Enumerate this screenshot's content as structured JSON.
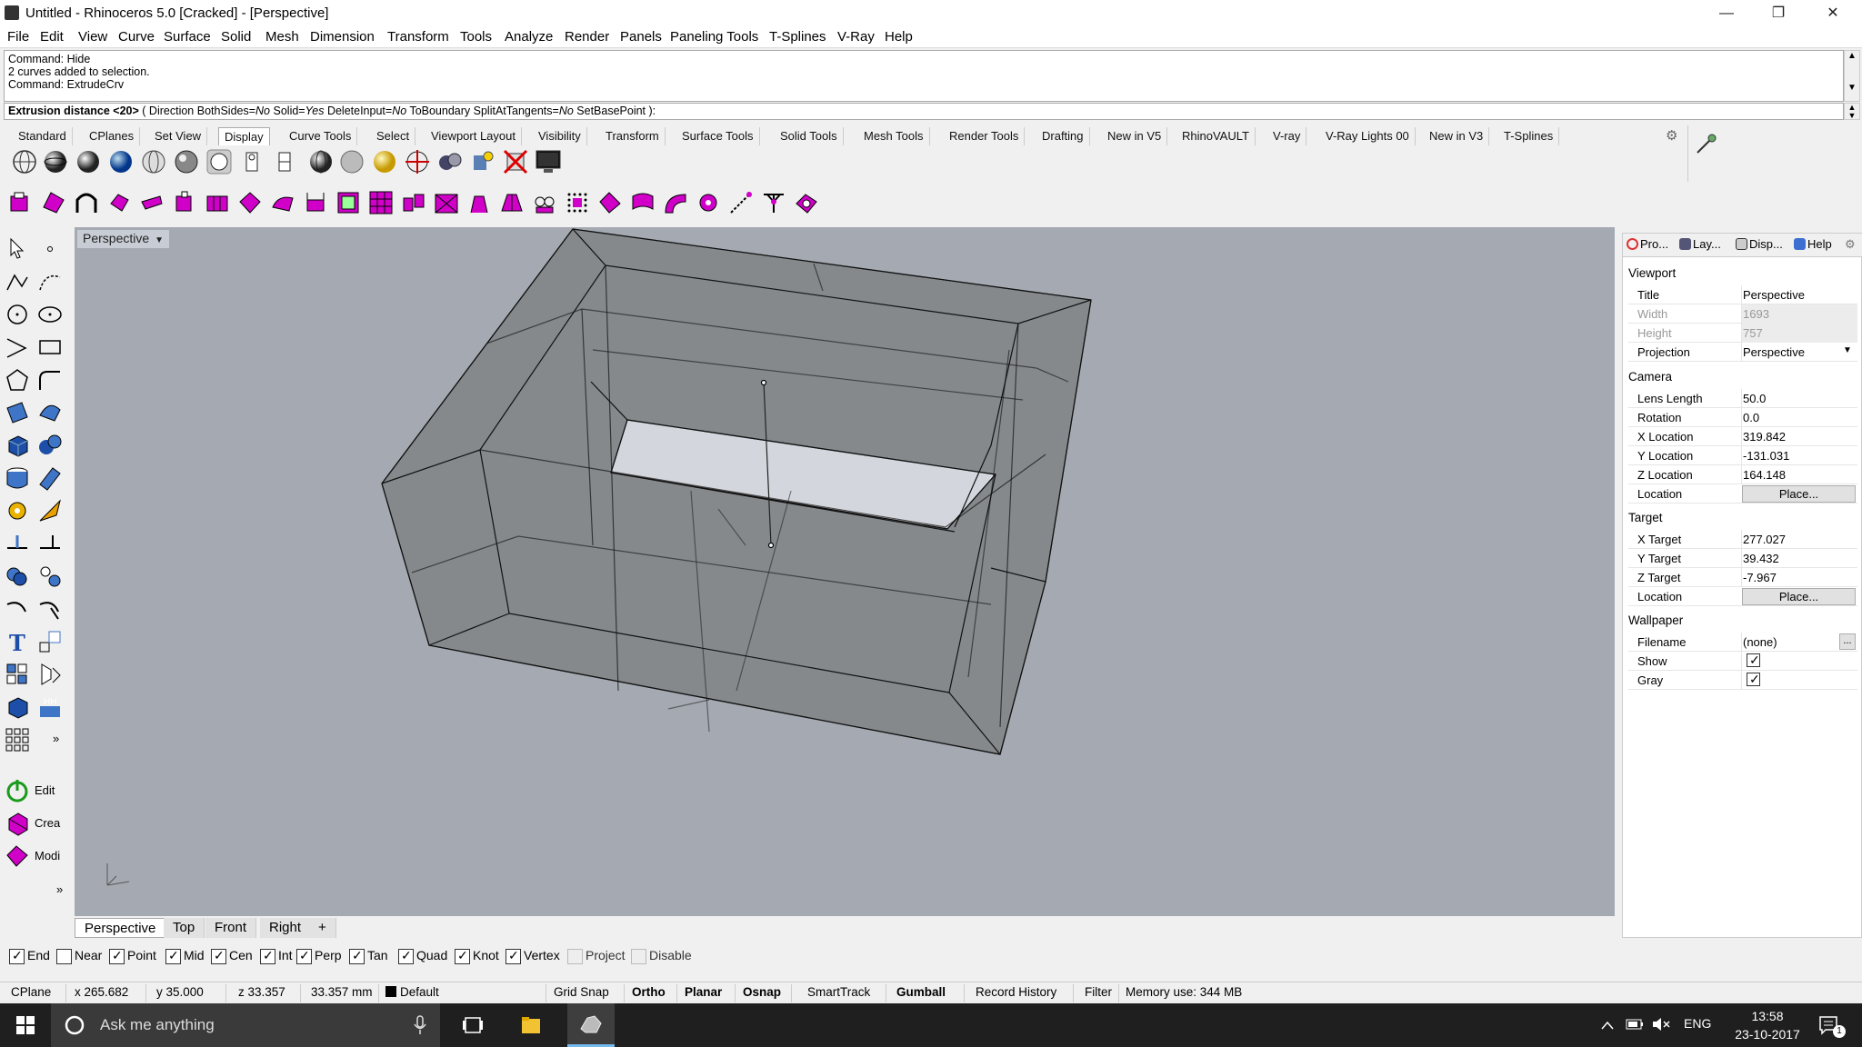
{
  "window": {
    "title": "Untitled - Rhinoceros 5.0 [Cracked] - [Perspective]",
    "minimize": "—",
    "maximize": "❐",
    "close": "✕"
  },
  "menu": [
    "File",
    "Edit",
    "View",
    "Curve",
    "Surface",
    "Solid",
    "Mesh",
    "Dimension",
    "Transform",
    "Tools",
    "Analyze",
    "Render",
    "Panels",
    "Paneling Tools",
    "T-Splines",
    "V-Ray",
    "Help"
  ],
  "command_history": [
    "Command: Hide",
    "2 curves added to selection.",
    "Command: ExtrudeCrv"
  ],
  "command_prompt": {
    "label": "Extrusion distance <20>",
    "open": " ( ",
    "direction": "Direction",
    "bothsides": "BothSides",
    "bothsides_val": "No",
    "solid": "Solid",
    "solid_val": "Yes",
    "deleteinput": "DeleteInput",
    "deleteinput_val": "No",
    "toboundary": "ToBoundary",
    "splitattangents": "SplitAtTangents",
    "splitattangents_val": "No",
    "setbasepoint": "SetBasePoint",
    "close": " ):"
  },
  "toolbar_tabs": [
    "Standard",
    "CPlanes",
    "Set View",
    "Display",
    "Curve Tools",
    "Select",
    "Viewport Layout",
    "Visibility",
    "Transform",
    "Surface Tools",
    "Solid Tools",
    "Mesh Tools",
    "Render Tools",
    "Drafting",
    "New in V5",
    "RhinoVAULT",
    "V-ray",
    "V-Ray Lights 00",
    "New in V3",
    "T-Splines"
  ],
  "active_tab": "Display",
  "left_toolbar": {
    "edit_label": "Edit",
    "create_label": "Crea",
    "modify_label": "Modi",
    "more": "»"
  },
  "viewport": {
    "title": "Perspective",
    "axis_label": "zy x"
  },
  "viewport_tabs": [
    "Perspective",
    "Top",
    "Front",
    "Right"
  ],
  "viewport_tab_add": "+",
  "osnaps": [
    {
      "label": "End",
      "checked": true
    },
    {
      "label": "Near",
      "checked": false
    },
    {
      "label": "Point",
      "checked": true
    },
    {
      "label": "Mid",
      "checked": true
    },
    {
      "label": "Cen",
      "checked": true
    },
    {
      "label": "Int",
      "checked": true
    },
    {
      "label": "Perp",
      "checked": true
    },
    {
      "label": "Tan",
      "checked": true
    },
    {
      "label": "Quad",
      "checked": true
    },
    {
      "label": "Knot",
      "checked": true
    },
    {
      "label": "Vertex",
      "checked": true
    },
    {
      "label": "Project",
      "checked": false
    },
    {
      "label": "Disable",
      "checked": false
    }
  ],
  "status": {
    "cplane": "CPlane",
    "x": "x 265.682",
    "y": "y 35.000",
    "z": "z 33.357",
    "dist": "33.357 mm",
    "layer": "Default",
    "grid_snap": "Grid Snap",
    "ortho": "Ortho",
    "planar": "Planar",
    "osnap": "Osnap",
    "smarttrack": "SmartTrack",
    "gumball": "Gumball",
    "record_history": "Record History",
    "filter": "Filter",
    "memory": "Memory use: 344 MB"
  },
  "panel": {
    "tabs": [
      "Pro...",
      "Lay...",
      "Disp...",
      "Help"
    ],
    "viewport_section": "Viewport",
    "title_k": "Title",
    "title_v": "Perspective",
    "width_k": "Width",
    "width_v": "1693",
    "height_k": "Height",
    "height_v": "757",
    "projection_k": "Projection",
    "projection_v": "Perspective",
    "camera_section": "Camera",
    "lens_k": "Lens Length",
    "lens_v": "50.0",
    "rotation_k": "Rotation",
    "rotation_v": "0.0",
    "xloc_k": "X Location",
    "xloc_v": "319.842",
    "yloc_k": "Y Location",
    "yloc_v": "-131.031",
    "zloc_k": "Z Location",
    "zloc_v": "164.148",
    "loc_k": "Location",
    "place": "Place...",
    "target_section": "Target",
    "xt_k": "X Target",
    "xt_v": "277.027",
    "yt_k": "Y Target",
    "yt_v": "39.432",
    "zt_k": "Z Target",
    "zt_v": "-7.967",
    "tloc_k": "Location",
    "wallpaper_section": "Wallpaper",
    "filename_k": "Filename",
    "filename_v": "(none)",
    "browse": "...",
    "show_k": "Show",
    "gray_k": "Gray"
  },
  "taskbar": {
    "search_placeholder": "Ask me anything",
    "lang": "ENG",
    "time": "13:58",
    "date": "23-10-2017",
    "notif_count": "1"
  }
}
